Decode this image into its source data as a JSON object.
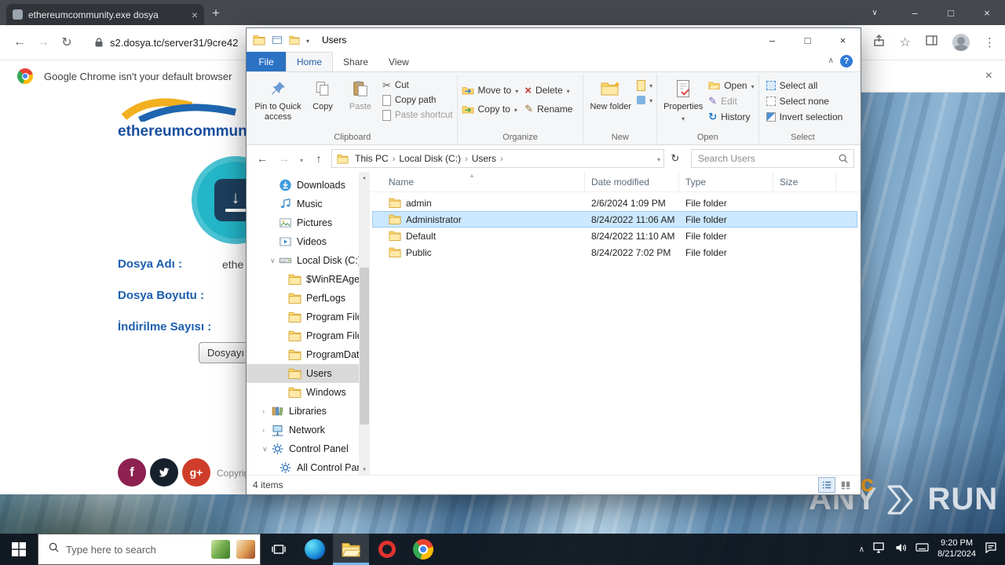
{
  "browser": {
    "tab_title": "ethereumcommunity.exe dosya",
    "new_tab_glyph": "+",
    "tab_close_glyph": "×",
    "window": {
      "tab_search_glyph": "∨",
      "minimize_glyph": "–",
      "maximize_glyph": "□",
      "close_glyph": "×"
    },
    "toolbar": {
      "back_glyph": "←",
      "forward_glyph": "→",
      "reload_glyph": "↻",
      "url": "s2.dosya.tc/server31/9cre42",
      "star_glyph": "☆",
      "menu_glyph": "⋮"
    },
    "notification": {
      "text": "Google Chrome isn't your default browser",
      "close_glyph": "×"
    }
  },
  "page": {
    "heading": "ethereumcommunity",
    "file_name_label": "Dosya Adı :",
    "file_name_value": "ethe",
    "file_size_label": "Dosya Boyutu :",
    "download_count_label": "İndirilme Sayısı :",
    "download_button_label": "Dosyayı",
    "copyright_text": "Copyrig",
    "orange_mark": "c",
    "download_arrow_glyph": "↓"
  },
  "explorer": {
    "window_title": "Users",
    "window_controls": {
      "minimize": "–",
      "maximize": "□",
      "close": "×"
    },
    "tabs": {
      "file": "File",
      "home": "Home",
      "share": "Share",
      "view": "View"
    },
    "help_glyph": "?",
    "collapse_glyph": "∧",
    "ribbon": {
      "pin": "Pin to Quick access",
      "copy": "Copy",
      "paste": "Paste",
      "cut": "Cut",
      "copy_path": "Copy path",
      "paste_shortcut": "Paste shortcut",
      "clipboard_label": "Clipboard",
      "move_to": "Move to",
      "copy_to": "Copy to",
      "delete": "Delete",
      "rename": "Rename",
      "organize_label": "Organize",
      "new_folder": "New folder",
      "new_label": "New",
      "properties": "Properties",
      "open": "Open",
      "edit": "Edit",
      "history": "History",
      "open_label": "Open",
      "select_all": "Select all",
      "select_none": "Select none",
      "invert_selection": "Invert selection",
      "select_label": "Select"
    },
    "navbar": {
      "back_glyph": "←",
      "forward_glyph": "→",
      "up_glyph": "↑",
      "refresh_glyph": "↻",
      "breadcrumbs": [
        "This PC",
        "Local Disk (C:)",
        "Users"
      ],
      "search_placeholder": "Search Users"
    },
    "tree": [
      {
        "label": "Downloads",
        "icon": "download",
        "indent": 2
      },
      {
        "label": "Music",
        "icon": "music",
        "indent": 2
      },
      {
        "label": "Pictures",
        "icon": "pictures",
        "indent": 2
      },
      {
        "label": "Videos",
        "icon": "videos",
        "indent": 2
      },
      {
        "label": "Local Disk (C:)",
        "icon": "drive",
        "indent": 2,
        "expand": "down"
      },
      {
        "label": "$WinREAgent",
        "icon": "folder",
        "indent": 3
      },
      {
        "label": "PerfLogs",
        "icon": "folder",
        "indent": 3
      },
      {
        "label": "Program Files",
        "icon": "folder",
        "indent": 3
      },
      {
        "label": "Program Files",
        "icon": "folder",
        "indent": 3
      },
      {
        "label": "ProgramData",
        "icon": "folder",
        "indent": 3
      },
      {
        "label": "Users",
        "icon": "folder",
        "indent": 3,
        "selected": true
      },
      {
        "label": "Windows",
        "icon": "folder",
        "indent": 3
      },
      {
        "label": "Libraries",
        "icon": "libraries",
        "indent": 1,
        "expand": "right"
      },
      {
        "label": "Network",
        "icon": "network",
        "indent": 1,
        "expand": "right"
      },
      {
        "label": "Control Panel",
        "icon": "control",
        "indent": 1,
        "expand": "down"
      },
      {
        "label": "All Control Pan",
        "icon": "control",
        "indent": 2
      }
    ],
    "columns": {
      "name": "Name",
      "date": "Date modified",
      "type": "Type",
      "size": "Size"
    },
    "files": [
      {
        "name": "admin",
        "date": "2/6/2024 1:09 PM",
        "type": "File folder",
        "size": ""
      },
      {
        "name": "Administrator",
        "date": "8/24/2022 11:06 AM",
        "type": "File folder",
        "size": "",
        "selected": true
      },
      {
        "name": "Default",
        "date": "8/24/2022 11:10 AM",
        "type": "File folder",
        "size": ""
      },
      {
        "name": "Public",
        "date": "8/24/2022 7:02 PM",
        "type": "File folder",
        "size": ""
      }
    ],
    "status_text": "4 items"
  },
  "taskbar": {
    "search_placeholder": "Type here to search",
    "clock_time": "9:20 PM",
    "clock_date": "8/21/2024"
  },
  "watermark": {
    "left": "ANY",
    "right": "RUN"
  }
}
